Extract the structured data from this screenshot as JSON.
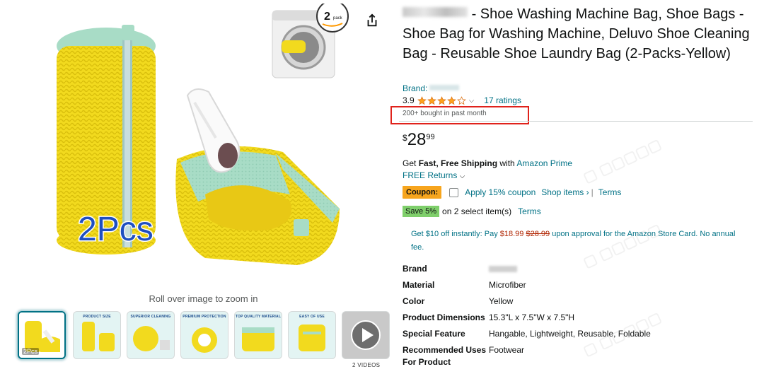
{
  "gallery": {
    "zoom_hint": "Roll over image to zoom in",
    "main_overlay_text": "2Pcs",
    "pack_badge": "2 pack",
    "thumbnails": [
      {
        "label": "",
        "count": "2Pcs"
      },
      {
        "label": "PRODUCT SIZE"
      },
      {
        "label": "SUPERIOR CLEANING"
      },
      {
        "label": "PREMIUM PROTECTION"
      },
      {
        "label": "TOP QUALITY MATERIAL"
      },
      {
        "label": "EASY OF USE"
      },
      {
        "label": ""
      }
    ],
    "video_caption": "2 VIDEOS"
  },
  "product": {
    "title": "- Shoe Washing Machine Bag, Shoe Bags - Shoe Bag for Washing Machine, Deluvo Shoe Cleaning Bag - Reusable Shoe Laundry Bag (2-Packs-Yellow)",
    "brand_label": "Brand:",
    "rating": "3.9",
    "stars_filled": 3.9,
    "stars_max": 5,
    "ratings_count": "17 ratings",
    "bought_text": "200+ bought in past month",
    "price": {
      "symbol": "$",
      "whole": "28",
      "fraction": "99"
    },
    "shipping": {
      "prefix": "Get ",
      "bold": "Fast, Free Shipping",
      "mid": " with ",
      "link": "Amazon Prime"
    },
    "returns": "FREE Returns",
    "coupon": {
      "badge": "Coupon:",
      "apply": "Apply 15% coupon",
      "shop_items": "Shop items ›",
      "terms": "Terms"
    },
    "save": {
      "badge": "Save 5%",
      "text": "on 2 select item(s)",
      "terms": "Terms"
    },
    "card_offer": {
      "text1": "Get $10 off instantly: Pay ",
      "new_price": "$18.99",
      "old_price": "$28.99",
      "text2": " upon approval for the Amazon Store Card. No annual fee."
    },
    "specs": [
      {
        "key": "Brand",
        "value": ""
      },
      {
        "key": "Material",
        "value": "Microfiber"
      },
      {
        "key": "Color",
        "value": "Yellow"
      },
      {
        "key": "Product Dimensions",
        "value": "15.3\"L x 7.5\"W x 7.5\"H"
      },
      {
        "key": "Special Feature",
        "value": "Hangable, Lightweight, Reusable, Foldable"
      },
      {
        "key": "Recommended Uses For Product",
        "value": "Footwear"
      }
    ]
  },
  "colors": {
    "link": "#007185",
    "coupon_badge": "#f7a51d",
    "save_badge": "#7fcf6b",
    "highlight_box": "#e0221b",
    "star": "#ffa41c"
  }
}
